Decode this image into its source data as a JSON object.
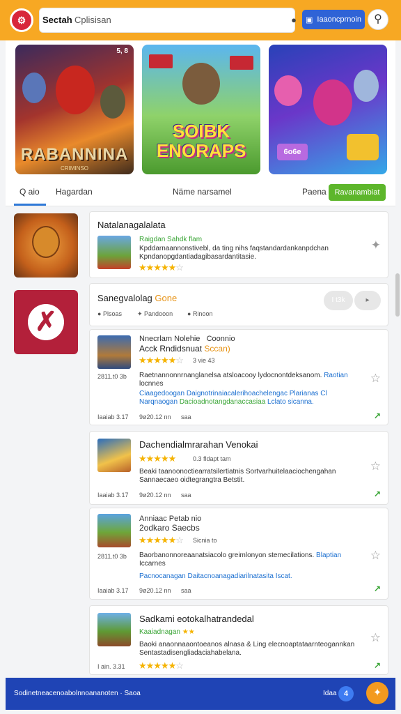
{
  "header": {
    "search_label": "Sectah",
    "search_placeholder": "Cplisisan",
    "icon_names": [
      "lock-icon",
      "sparkle-icon",
      "clear-icon"
    ],
    "action_button_label": "Iaaoncprnoin",
    "search_icon": "magnifier-icon"
  },
  "banners": [
    {
      "title": "RABANNINA",
      "subtitle": "CRIMINSO",
      "badge": "5, 8"
    },
    {
      "title_line1": "SOIBK",
      "title_line2": "ENORAPS"
    },
    {
      "badge": "6o6e"
    }
  ],
  "tabs": {
    "items": [
      "Q aio",
      "Hagardan",
      "Näme narsamel",
      "Paena"
    ],
    "active_index": 0,
    "button_label": "Ravanambiat"
  },
  "cards": [
    {
      "title": "Natalanagalalata",
      "subtitle": "Raigdan Sahdk flam",
      "desc": [
        "Kpddarnaannonstivebl, da ting nihs faqstandardankanpdchan",
        "Kpndanopgdantiadagibasardantitasie."
      ],
      "rating": 4.5
    },
    {
      "title": "Sanegvalolag",
      "title_accent": "Gone",
      "chips": [
        "Plsoas",
        "Pandooon",
        "Rinoon"
      ],
      "pill_left": "I t3k",
      "pill_right": "I"
    },
    {
      "title_line1": "Nnecrlam Nolehie",
      "title_line1_b": "Coonnio",
      "title_line2": "Acck Rndidsnuat",
      "title_line2_b": "Sccan)",
      "rating": 4.5,
      "rating_note": "3 vie 43",
      "date": "2811.t0 3b",
      "desc1": "Raetnannonnrnanglanelsa atsloacooy lydocnontdeksanom.",
      "desc1_link": "Raotian",
      "desc2": "locnnes",
      "link_line_a": "Ciaagedoogan",
      "link_line_b": "Daignotrinaiacalerihoachelengac Plarianas",
      "link_line_c": "Cl",
      "link_line2_a": "Narqnaogan",
      "link_line2_b": "Dacioadnotangdanaccasiaa",
      "link_line2_c": "Lclato sicanna.",
      "footer": [
        "Iaaiab 3.17",
        "9ø20.12 nn",
        "saa"
      ]
    },
    {
      "title": "Dachendialmrarahan Venokai",
      "rating": 5,
      "rating_note": "0.3 fldapt tam",
      "desc": [
        "Beaki taanoonoctiearratsilertiatnis Sortvarhuitelaaciochengahan",
        "Sannaecaeo oidtegrangtra Betstit."
      ],
      "footer": [
        "Iaaiab 3.17",
        "9ø20.12 nn",
        "saa"
      ]
    },
    {
      "title_line1": "Anniaac Petab nio",
      "title_line2": "2odkaro Saecbs",
      "rating": 4.5,
      "rating_note": "Sicnia to",
      "date": "2811.t0 3b",
      "desc1": "Baorbanonnoreaanatsiacolo greimlonyon stemecilations.",
      "desc1_link": "Blaptian",
      "desc2": "Iccarnes",
      "link_line_a": "Pacnocanagan",
      "link_line_b": "Daitacnoanagadiarilnatasita Iscat.",
      "footer": [
        "Iaaiab 3.17",
        "9ø20.12 nn",
        "saa"
      ]
    },
    {
      "title": "Sadkami eotokalhatrandedal",
      "subtitle": "Kaaiadnagan",
      "rating": 4.5,
      "desc": [
        "Baoki anaonnaaontoeanos alnasa & Ling elecnoaptataarnteogannkan",
        "Sentastadisengliadaciahabelana."
      ],
      "footer": [
        "I ain. 3.31",
        "9ø20.12 nn",
        "saa"
      ]
    }
  ],
  "bottom": {
    "left_text": "Sodinetneacenoabolnnoananoten · Saoa",
    "right_text": "Idaa",
    "badge": "4"
  },
  "colors": {
    "topbar": "#f7a823",
    "primary_blue": "#1f44b5",
    "accent_green": "#5db62b",
    "star": "#f5b301",
    "logo_red": "#d8263a"
  }
}
